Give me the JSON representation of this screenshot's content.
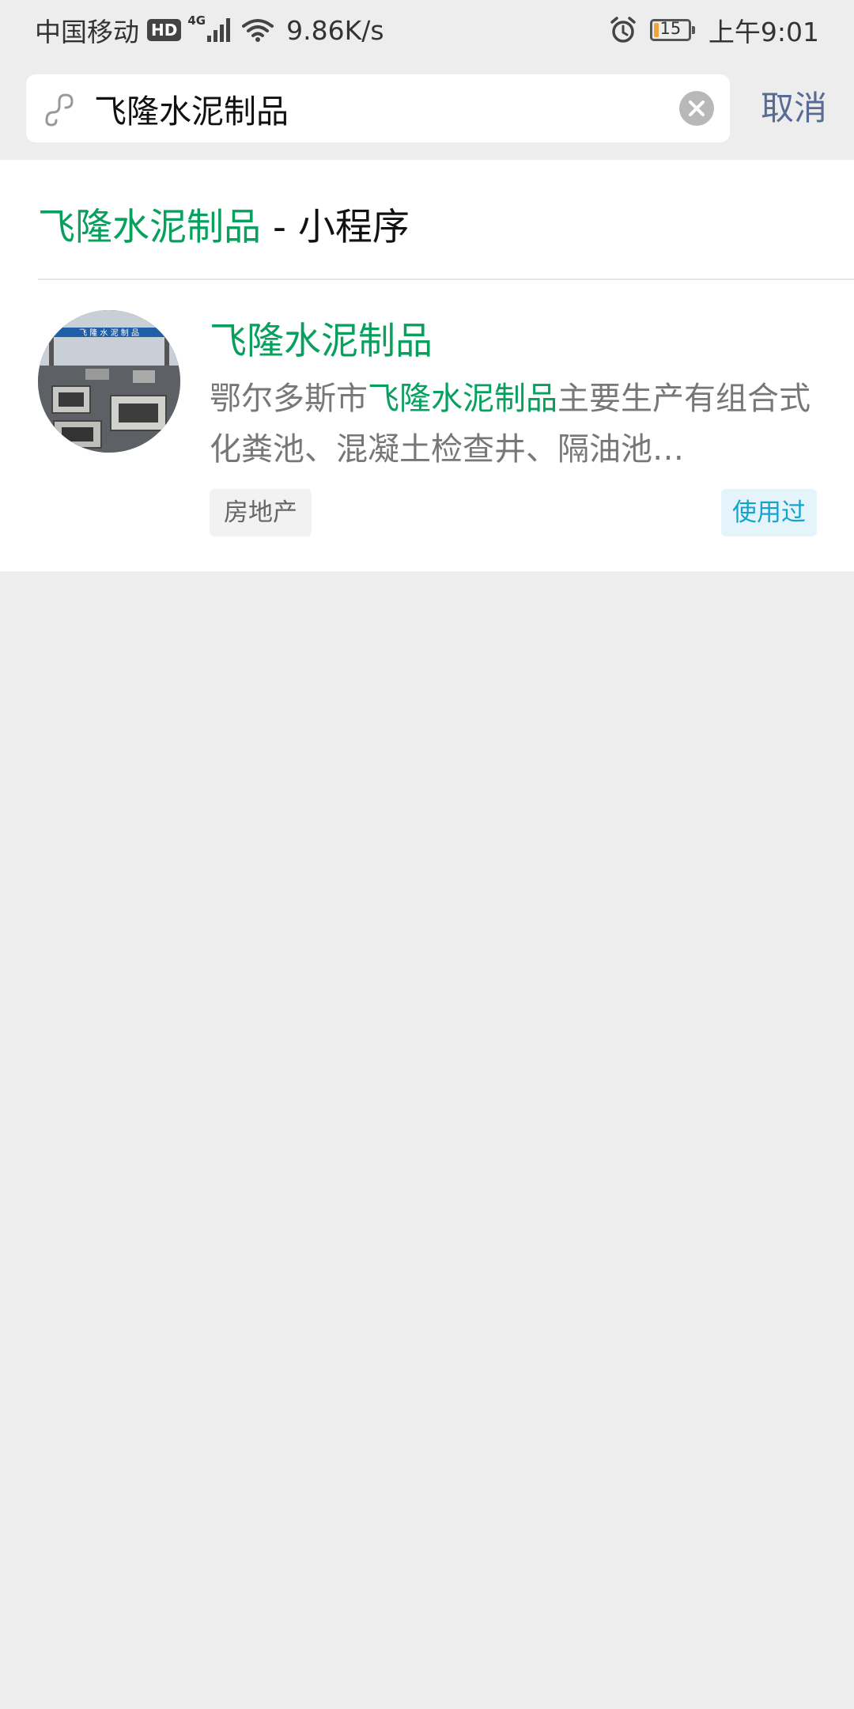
{
  "status_bar": {
    "carrier": "中国移动",
    "hd_badge": "HD",
    "network_type": "4G",
    "net_speed": "9.86K/s",
    "battery_level": "15",
    "time": "上午9:01",
    "icons": [
      "signal-icon",
      "wifi-icon",
      "alarm-icon",
      "battery-icon"
    ],
    "battery_fill_fraction": 0.15,
    "battery_color": "#f2a33a"
  },
  "search": {
    "icon": "mini-program-icon",
    "query": "飞隆水泥制品",
    "clear_icon": "clear-icon",
    "cancel_label": "取消"
  },
  "section": {
    "keyword": "飞隆水泥制品",
    "suffix": " - 小程序"
  },
  "result": {
    "title": "飞隆水泥制品",
    "desc_prefix": "鄂尔多斯市",
    "desc_keyword": "飞隆水泥制品",
    "desc_suffix": "主要生产有组合式化粪池、混凝土检查井、隔油池…",
    "avatar_banner_text": "飞 隆 水 泥 制 品",
    "category_tag": "房地产",
    "used_tag": "使用过"
  },
  "colors": {
    "highlight_green": "#07a05d",
    "link_blue": "#576b95",
    "background": "#ededed",
    "used_tag_blue": "#14a4cb"
  }
}
